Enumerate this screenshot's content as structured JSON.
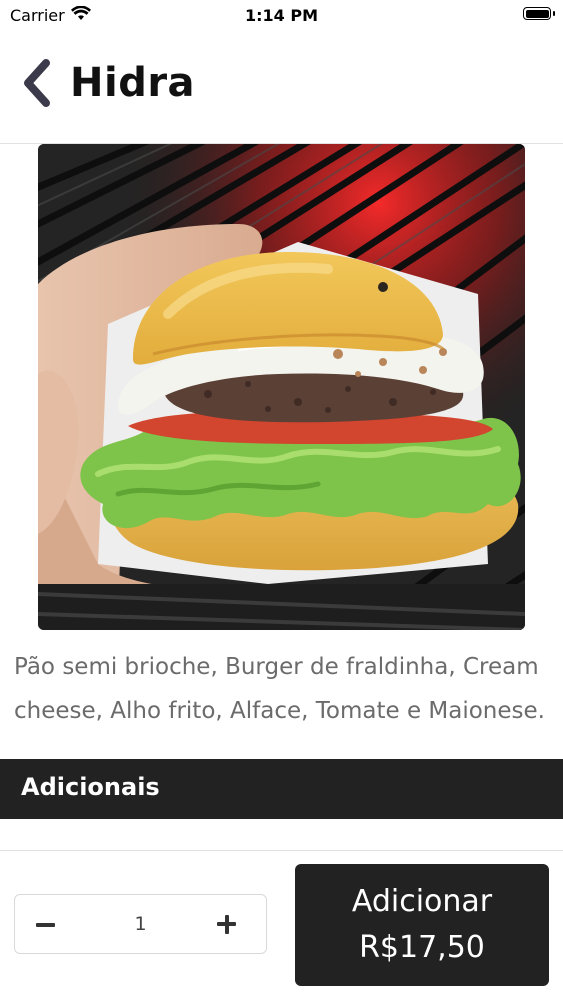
{
  "status_bar": {
    "carrier": "Carrier",
    "time": "1:14 PM"
  },
  "header": {
    "back_icon": "chevron-left-icon",
    "title": "Hidra"
  },
  "product": {
    "image_subject": "burger-photo",
    "description": "Pão semi brioche, Burger de fraldinha, Cream cheese, Alho frito, Alface, Tomate e Maionese."
  },
  "extras": {
    "title": "Adicionais"
  },
  "order": {
    "quantity": "1",
    "add_label": "Adicionar",
    "price": "R$17,50"
  },
  "colors": {
    "dark": "#222222",
    "text_muted": "#6b6b6b",
    "divider": "#e2e2e2"
  }
}
